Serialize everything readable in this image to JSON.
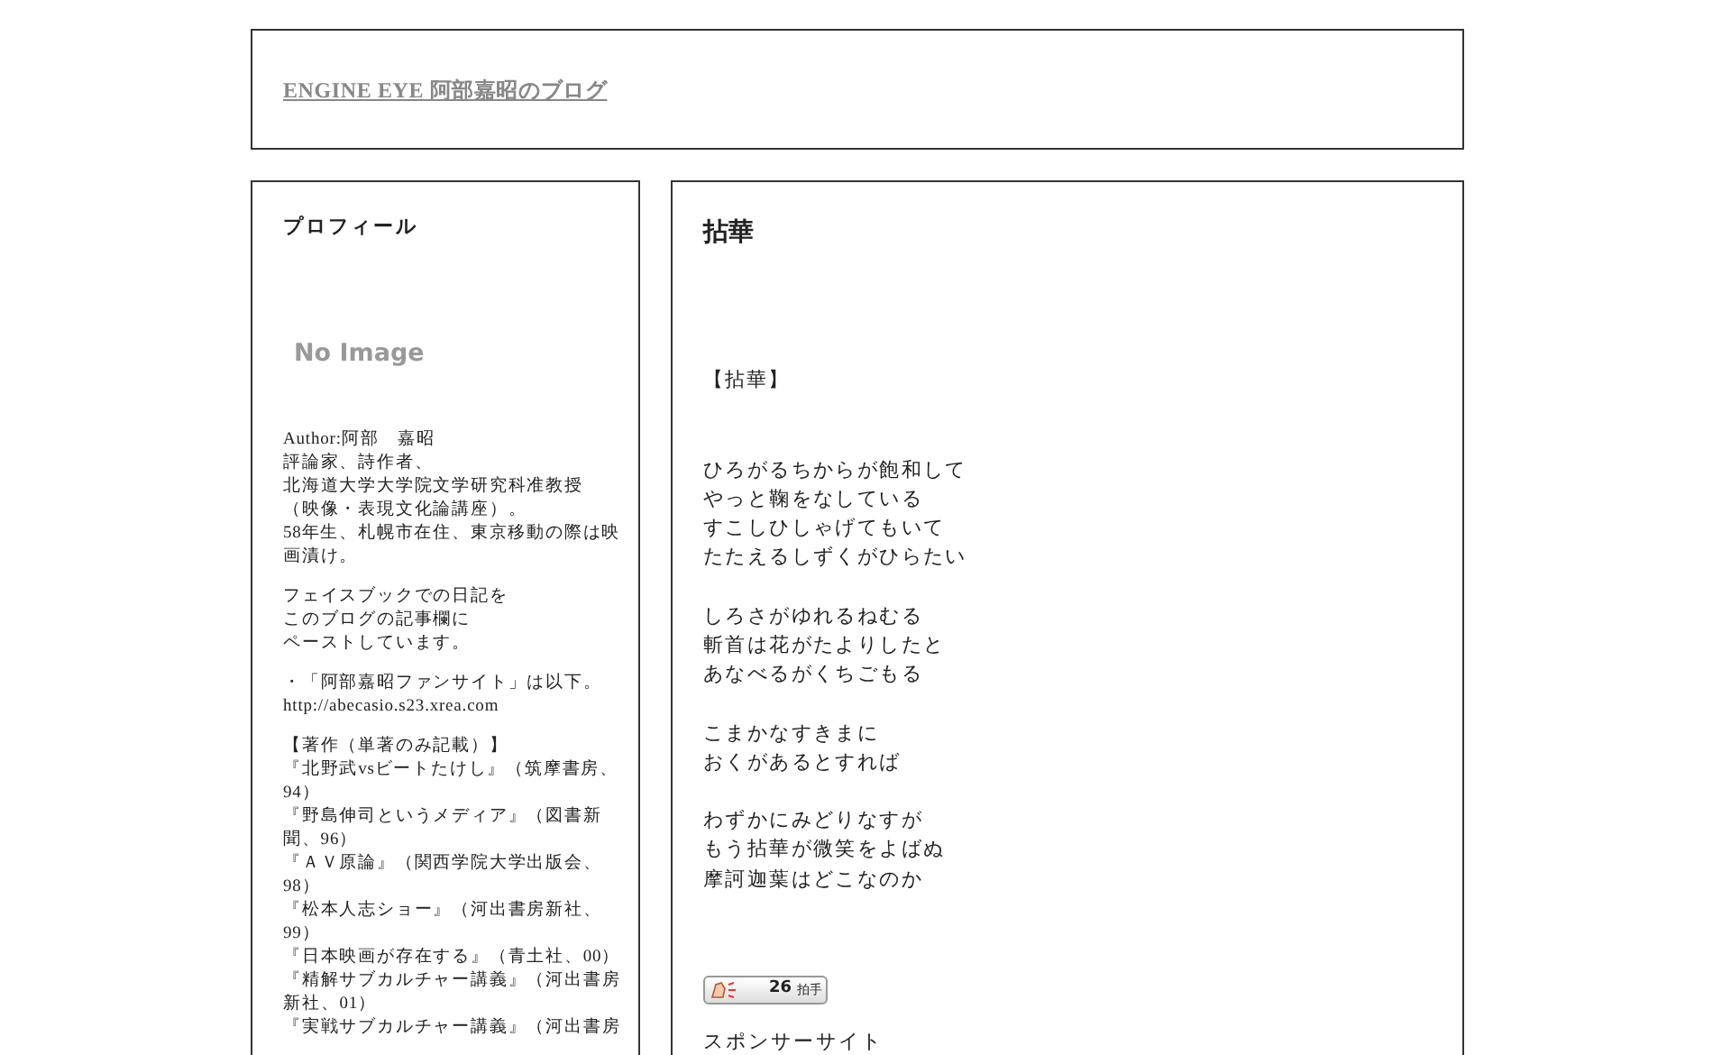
{
  "header": {
    "title": "ENGINE EYE 阿部嘉昭のブログ"
  },
  "sidebar": {
    "heading": "プロフィール",
    "image_placeholder": "No Image",
    "paragraphs": [
      [
        "Author:阿部　嘉昭",
        "評論家、詩作者、",
        "北海道大学大学院文学研究科准教授",
        "（映像・表現文化論講座）。",
        "58年生、札幌市在住、東京移動の際は映",
        "画漬け。"
      ],
      [
        "フェイスブックでの日記を",
        "このブログの記事欄に",
        "ペーストしています。"
      ],
      [
        "・「阿部嘉昭ファンサイト」は以下。",
        "http://abecasio.s23.xrea.com"
      ],
      [
        "【著作（単著のみ記載）】",
        "『北野武vsビートたけし』（筑摩書房、",
        "94）",
        "『野島伸司というメディア』（図書新",
        "聞、96）",
        "『ＡＶ原論』（関西学院大学出版会、",
        "98）",
        "『松本人志ショー』（河出書房新社、",
        "99）",
        "『日本映画が存在する』（青土社、00）",
        "『精解サブカルチャー講義』（河出書房",
        "新社、01）",
        "『実戦サブカルチャー講義』（河出書房"
      ]
    ]
  },
  "post": {
    "title": "拈華",
    "subtitle": "【拈華】",
    "stanzas": [
      [
        "ひろがるちからが飽和して",
        "やっと鞠をなしている",
        "すこしひしゃげてもいて",
        "たたえるしずくがひらたい"
      ],
      [
        "しろさがゆれるねむる",
        "斬首は花がたよりしたと",
        "あなべるがくちごもる"
      ],
      [
        "こまかなすきまに",
        "おくがあるとすれば"
      ],
      [
        "わずかにみどりなすが",
        "もう拈華が微笑をよばぬ",
        "摩訶迦葉はどこなのか"
      ]
    ],
    "clap": {
      "count": "26",
      "label": "拍手"
    },
    "sponsor_heading": "スポンサーサイト"
  }
}
